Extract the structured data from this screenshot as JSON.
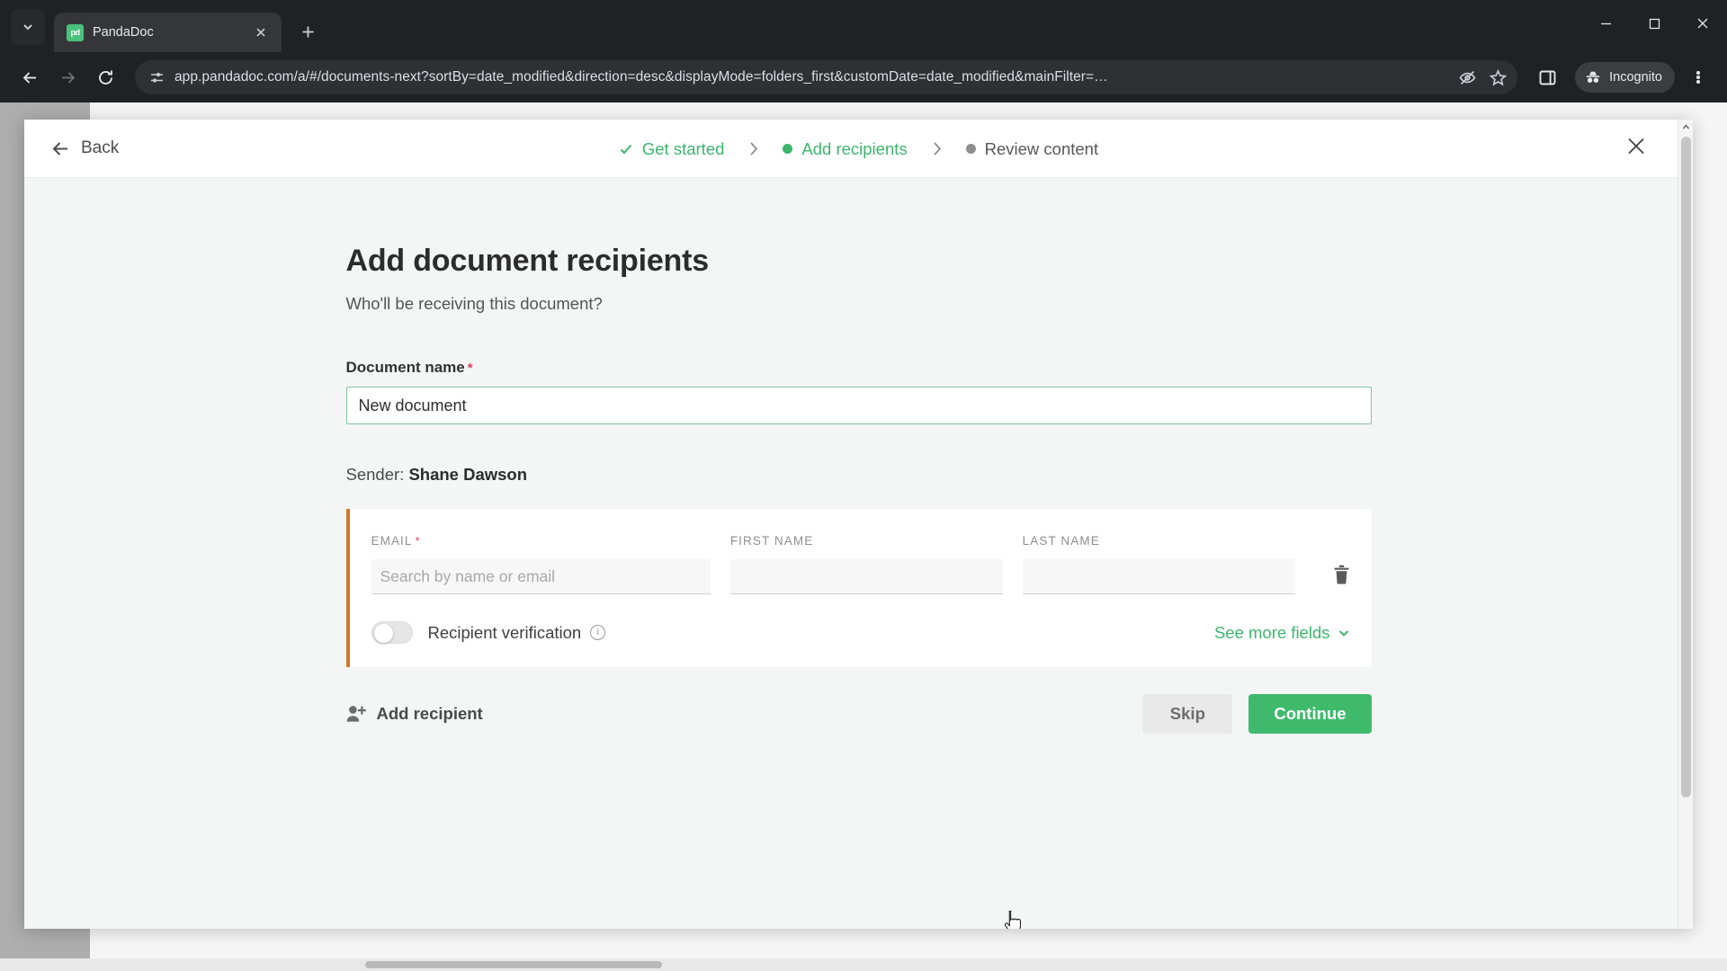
{
  "browser": {
    "tab": {
      "title": "PandaDoc",
      "favicon_text": "pd",
      "favicon_color": "#4bc27c"
    },
    "tab_list_icon": "chevron-down-icon",
    "new_tab_icon": "plus-icon",
    "window_controls": [
      "minimize",
      "maximize",
      "close"
    ],
    "nav": {
      "back_icon": "arrow-left-icon",
      "forward_icon": "arrow-right-icon",
      "reload_icon": "reload-icon"
    },
    "omnibox": {
      "site_settings_icon": "tune-icon",
      "url": "app.pandadoc.com/a/#/documents-next?sortBy=date_modified&direction=desc&displayMode=folders_first&customDate=date_modified&mainFilter=…",
      "url_host": "app.pandadoc.com",
      "tracking_protection_icon": "eye-off-icon",
      "bookmark_icon": "star-icon",
      "side_panel_icon": "side-panel-icon"
    },
    "incognito": {
      "label": "Incognito",
      "icon": "incognito-icon"
    },
    "menu_icon": "kebab-menu-icon"
  },
  "modal": {
    "back_label": "Back",
    "back_icon": "arrow-left-icon",
    "close_icon": "close-icon",
    "accent_color": "#2e7d52",
    "steps": [
      {
        "label": "Get started",
        "state": "done",
        "marker": "check-icon"
      },
      {
        "label": "Add recipients",
        "state": "active",
        "marker": "dot"
      },
      {
        "label": "Review content",
        "state": "todo",
        "marker": "dot"
      }
    ],
    "step_separator_icon": "chevron-right-icon"
  },
  "main": {
    "title": "Add document recipients",
    "subtitle": "Who'll be receiving this document?",
    "document_name": {
      "label": "Document name",
      "required_mark": "*",
      "value": "New document"
    },
    "sender": {
      "prefix": "Sender:",
      "name": "Shane Dawson"
    },
    "recipient_row": {
      "accent_color": "#d4792a",
      "email": {
        "label": "EMAIL",
        "required_mark": "*",
        "placeholder": "Search by name or email",
        "value": ""
      },
      "first_name": {
        "label": "FIRST NAME",
        "placeholder": "",
        "value": ""
      },
      "last_name": {
        "label": "LAST NAME",
        "placeholder": "",
        "value": ""
      },
      "delete_icon": "trash-icon",
      "verification": {
        "label": "Recipient verification",
        "state": "off",
        "info_icon": "info-icon",
        "info_glyph": "i"
      },
      "see_more": {
        "label": "See more fields",
        "icon": "chevron-down-icon"
      }
    },
    "add_recipient": {
      "label": "Add recipient",
      "icon": "user-plus-icon"
    },
    "buttons": {
      "skip": {
        "label": "Skip",
        "color": "#e9e9e9"
      },
      "continue": {
        "label": "Continue",
        "color": "#3fba6d"
      }
    }
  }
}
